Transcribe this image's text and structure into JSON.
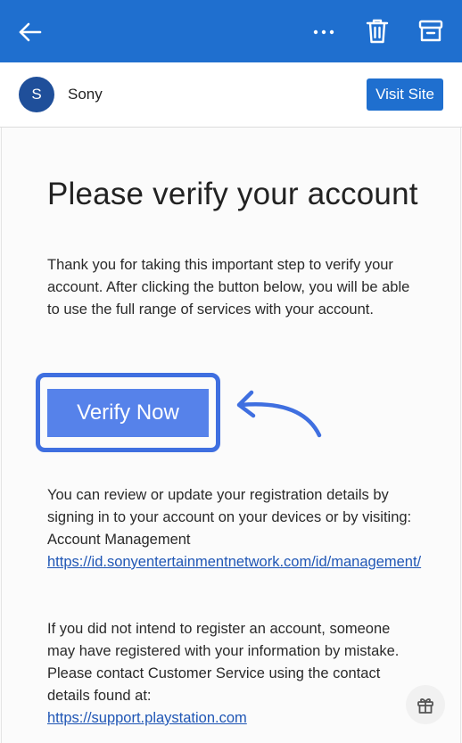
{
  "header": {
    "icons": [
      "back-arrow-icon",
      "more-options-icon",
      "trash-icon",
      "archive-icon"
    ],
    "color": "#1f6fcf"
  },
  "sender": {
    "avatar_letter": "S",
    "name": "Sony",
    "visit_label": "Visit Site"
  },
  "email": {
    "headline": "Please verify your account",
    "intro": "Thank you for taking this important step to verify your account. After clicking the button below, you will be able to use the full range of services with your account.",
    "verify_label": "Verify Now",
    "registration_text": "You can review or update your registration details by signing in to your account on your devices or by visiting: Account Management",
    "account_link": "https://id.sonyentertainmentnetwork.com/id/management/",
    "notice_text": "If you did not intend to register an account, someone may have registered with your information by mistake. Please contact Customer Service using the contact details found at:",
    "support_link": "https://support.playstation.com"
  },
  "accent_colors": {
    "button": "#5682ea",
    "highlight_outline": "#3f6fe0",
    "link": "#1f56b5"
  }
}
